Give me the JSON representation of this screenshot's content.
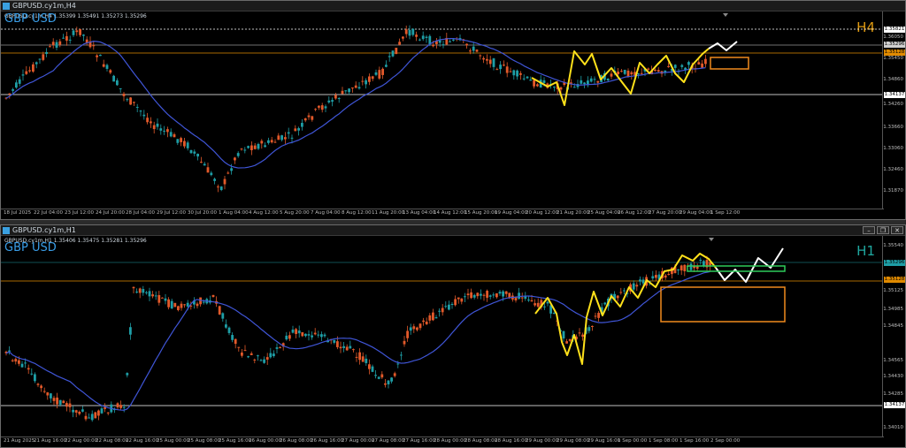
{
  "colors": {
    "bull": "#1e9ea6",
    "bear": "#e2592a",
    "ma": "#3f55d6",
    "yellow_path": "#ffe11a",
    "white_path": "#ffffff",
    "orange_line": "#e08a00",
    "white_line": "#ffffff",
    "orange_box": "#f08a1e",
    "green_box": "#2ecc5a",
    "symbol_text": "#3a9ee8",
    "tf_h4": "#e09a10",
    "tf_h1": "#1fa8a0"
  },
  "icons": [
    "chart-window-icon",
    "minimize-icon",
    "restore-icon",
    "close-icon"
  ],
  "window_h4": {
    "title": "GBPUSD.cy1m,H4",
    "ohlc": "GBPUSD.cy1m,H4  1.35399  1.35491  1.35273  1.35296",
    "symbol": "GBP USD",
    "timeframe": "H4",
    "price_ticks": [
      "1.36050",
      "1.35450",
      "1.34860",
      "1.34260",
      "1.33660",
      "1.33060",
      "1.32460",
      "1.31870"
    ],
    "tags": {
      "top": "1.35821",
      "current": "1.35296",
      "orange": "1.35128",
      "white_low": "1.34137"
    },
    "time_ticks": [
      "18 Jul 2025",
      "22 Jul 04:00",
      "23 Jul 12:00",
      "24 Jul 20:00",
      "28 Jul 04:00",
      "29 Jul 12:00",
      "30 Jul 20:00",
      "1 Aug 04:00",
      "4 Aug 12:00",
      "5 Aug 20:00",
      "7 Aug 04:00",
      "8 Aug 12:00",
      "11 Aug 20:00",
      "13 Aug 04:00",
      "14 Aug 12:00",
      "15 Aug 20:00",
      "19 Aug 04:00",
      "20 Aug 12:00",
      "21 Aug 20:00",
      "25 Aug 04:00",
      "26 Aug 12:00",
      "27 Aug 20:00",
      "29 Aug 04:00",
      "1 Sep 12:00"
    ]
  },
  "window_h1": {
    "title": "GBPUSD.cy1m,H1",
    "ohlc": "GBPUSD.cy1m,H1  1.35406  1.35475  1.35281  1.35296",
    "symbol": "GBP USD",
    "timeframe": "H1",
    "price_ticks": [
      "1.35540",
      "1.35125",
      "1.34985",
      "1.34845",
      "1.34565",
      "1.34430",
      "1.34285",
      "1.34010"
    ],
    "tags": {
      "current": "1.35296",
      "orange": "1.35128",
      "white_low": "1.34137"
    },
    "time_ticks": [
      "21 Aug 2025",
      "21 Aug 16:00",
      "22 Aug 00:00",
      "22 Aug 08:00",
      "22 Aug 16:00",
      "25 Aug 00:00",
      "25 Aug 08:00",
      "25 Aug 16:00",
      "26 Aug 00:00",
      "26 Aug 08:00",
      "26 Aug 16:00",
      "27 Aug 00:00",
      "27 Aug 08:00",
      "27 Aug 16:00",
      "28 Aug 00:00",
      "28 Aug 08:00",
      "28 Aug 16:00",
      "29 Aug 00:00",
      "29 Aug 08:00",
      "29 Aug 16:00",
      "1 Sep 00:00",
      "1 Sep 08:00",
      "1 Sep 16:00",
      "2 Sep 00:00"
    ]
  }
}
